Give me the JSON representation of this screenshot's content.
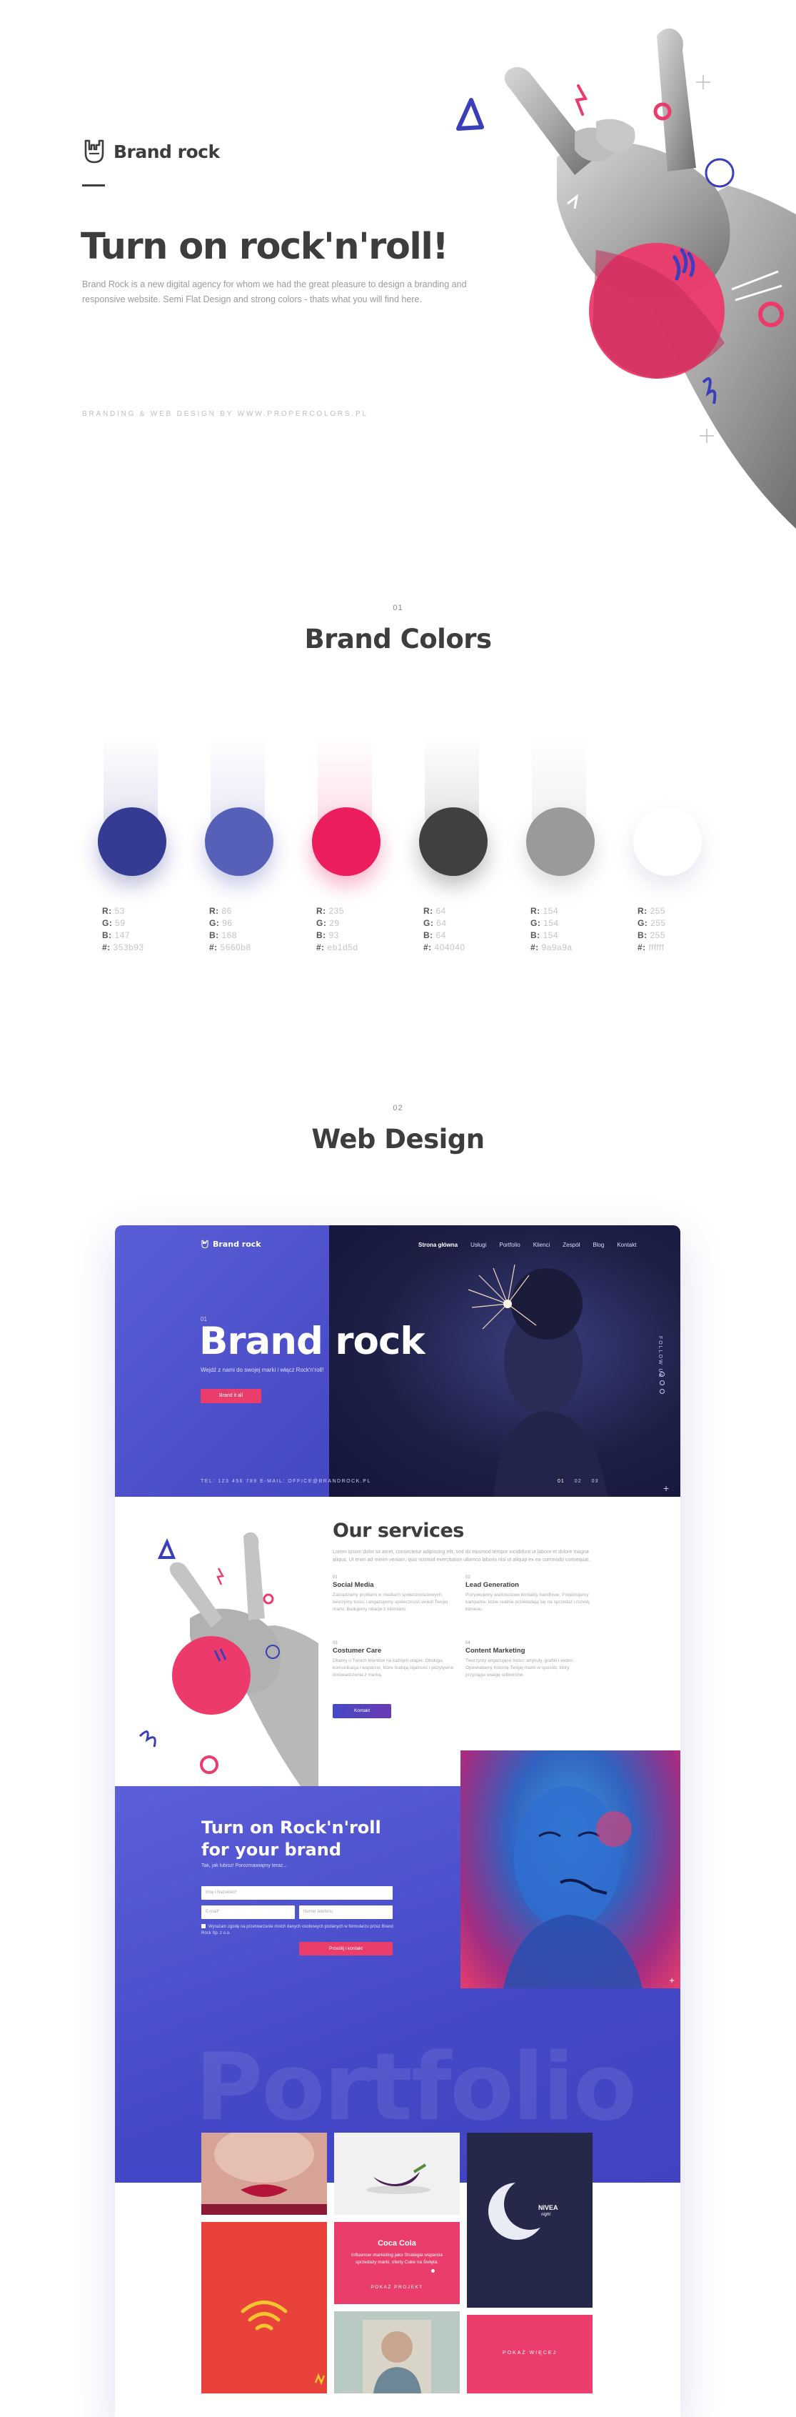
{
  "hero": {
    "brand": "Brand rock",
    "title": "Turn on rock'n'roll!",
    "description": "Brand Rock is a new digital agency for whom we had the great pleasure to design a branding and responsive website. Semi Flat Design and strong colors - thats what you will find here.",
    "credit": "BRANDING & WEB DESIGN BY WWW.PROPERCOLORS.PL"
  },
  "colors_section": {
    "number": "01",
    "title": "Brand Colors",
    "swatches": [
      {
        "hex_color": "#353b93",
        "r": "53",
        "g": "59",
        "b": "147",
        "hex": "353b93"
      },
      {
        "hex_color": "#5660b8",
        "r": "86",
        "g": "96",
        "b": "168",
        "hex": "5660b8"
      },
      {
        "hex_color": "#eb1d5d",
        "r": "235",
        "g": "29",
        "b": "93",
        "hex": "eb1d5d"
      },
      {
        "hex_color": "#404040",
        "r": "64",
        "g": "64",
        "b": "64",
        "hex": "404040"
      },
      {
        "hex_color": "#9a9a9a",
        "r": "154",
        "g": "154",
        "b": "154",
        "hex": "9a9a9a"
      },
      {
        "hex_color": "#ffffff",
        "r": "255",
        "g": "255",
        "b": "255",
        "hex": "ffffff"
      }
    ],
    "labels": {
      "r": "R:",
      "g": "G:",
      "b": "B:",
      "hash": "#:"
    }
  },
  "web_section": {
    "number": "02",
    "title": "Web Design"
  },
  "mockup": {
    "nav": {
      "brand": "Brand rock",
      "items": [
        "Strona główna",
        "Usługi",
        "Portfolio",
        "Klienci",
        "Zespół",
        "Blog",
        "Kontakt"
      ]
    },
    "hero": {
      "slide": "01",
      "title": "Brand rock",
      "subtitle": "Wejdź z nami do swojej marki i włącz Rock'n'roll!",
      "button": "Brand it all",
      "contact": "TEL: 123 456 789      E-MAIL: OFFICE@BRANDROCK.PL",
      "pages": [
        "01",
        "02",
        "03"
      ],
      "follow": "FOLLOW US"
    },
    "services": {
      "title": "Our services",
      "intro": "Lorem ipsum dolor sit amet, consectetur adipiscing elit, sed do eiusmod tempor incididunt ut labore et dolore magna aliqua. Ut enim ad minim veniam, quis nostrud exercitation ullamco laboris nisi ut aliquip ex ea commodo consequat.",
      "items": [
        {
          "num": "01",
          "name": "Social Media",
          "text": "Zarządzamy profilami w mediach społecznościowych, tworzymy treści i angażujemy społeczność wokół Twojej marki. Budujemy relacje z klientami."
        },
        {
          "num": "02",
          "name": "Lead Generation",
          "text": "Pozyskujemy wartościowe kontakty handlowe. Projektujemy kampanie, które realnie przekładają się na sprzedaż i rozwój biznesu."
        },
        {
          "num": "03",
          "name": "Costumer Care",
          "text": "Dbamy o Twoich klientów na każdym etapie. Obsługa, komunikacja i wsparcie, które budują lojalność i pozytywne doświadczenia z marką."
        },
        {
          "num": "04",
          "name": "Content Marketing",
          "text": "Tworzymy angażujące treści: artykuły, grafiki i wideo. Opowiadamy historię Twojej marki w sposób, który przyciąga uwagę odbiorców."
        }
      ],
      "button": "Kontakt"
    },
    "cta": {
      "title_line1": "Turn on Rock'n'roll",
      "title_line2": "for your brand",
      "subtitle": "Tak, jak lubisz! Porozmawiajmy teraz...",
      "fields": {
        "name": "Imię i Nazwisko*",
        "email": "E-mail*",
        "phone": "Numer telefonu"
      },
      "consent": "Wyrażam zgodę na przetwarzanie moich danych osobowych podanych w formularzu przez Brand Rock Sp. z o.o.",
      "button": "Prześlij i kontakt"
    },
    "portfolio": {
      "bg_text": "Portfolio",
      "cocacola": {
        "title": "Coca Cola",
        "text": "Influencer marketing jako Strategia wsparcia sprzedaży marki, oferty Coke na Święta.",
        "link": "POKAŻ PROJEKT"
      },
      "nivea": {
        "brand": "NIVEA",
        "sub": "night"
      },
      "more": "POKAŻ WIĘCEJ"
    }
  }
}
